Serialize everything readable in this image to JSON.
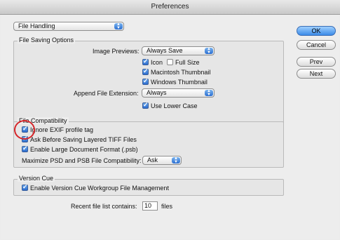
{
  "window": {
    "title": "Preferences"
  },
  "section_select": {
    "value": "File Handling"
  },
  "buttons": {
    "ok": "OK",
    "cancel": "Cancel",
    "prev": "Prev",
    "next": "Next"
  },
  "file_saving": {
    "title": "File Saving Options",
    "image_previews": {
      "label": "Image Previews:",
      "value": "Always Save"
    },
    "icon": {
      "label": "Icon",
      "checked": true
    },
    "full_size": {
      "label": "Full Size",
      "checked": false
    },
    "mac_thumb": {
      "label": "Macintosh Thumbnail",
      "checked": true
    },
    "win_thumb": {
      "label": "Windows Thumbnail",
      "checked": true
    },
    "append_ext": {
      "label": "Append File Extension:",
      "value": "Always"
    },
    "lower_case": {
      "label": "Use Lower Case",
      "checked": true
    }
  },
  "file_compat": {
    "title": "File Compatibility",
    "ignore_exif": {
      "label": "Ignore EXIF profile tag",
      "checked": true
    },
    "ask_tiff": {
      "label": "Ask Before Saving Layered TIFF Files",
      "checked": true
    },
    "large_doc": {
      "label": "Enable Large Document Format (.psb)",
      "checked": true
    },
    "maximize": {
      "label": "Maximize PSD and PSB File Compatibility:",
      "value": "Ask"
    }
  },
  "version_cue": {
    "title": "Version Cue",
    "enable": {
      "label": "Enable Version Cue Workgroup File Management",
      "checked": true
    }
  },
  "recent": {
    "label": "Recent file list contains:",
    "value": "10",
    "suffix": "files"
  },
  "colors": {
    "annotation_ring": "#d6262a",
    "accent": "#2c6fd1"
  }
}
